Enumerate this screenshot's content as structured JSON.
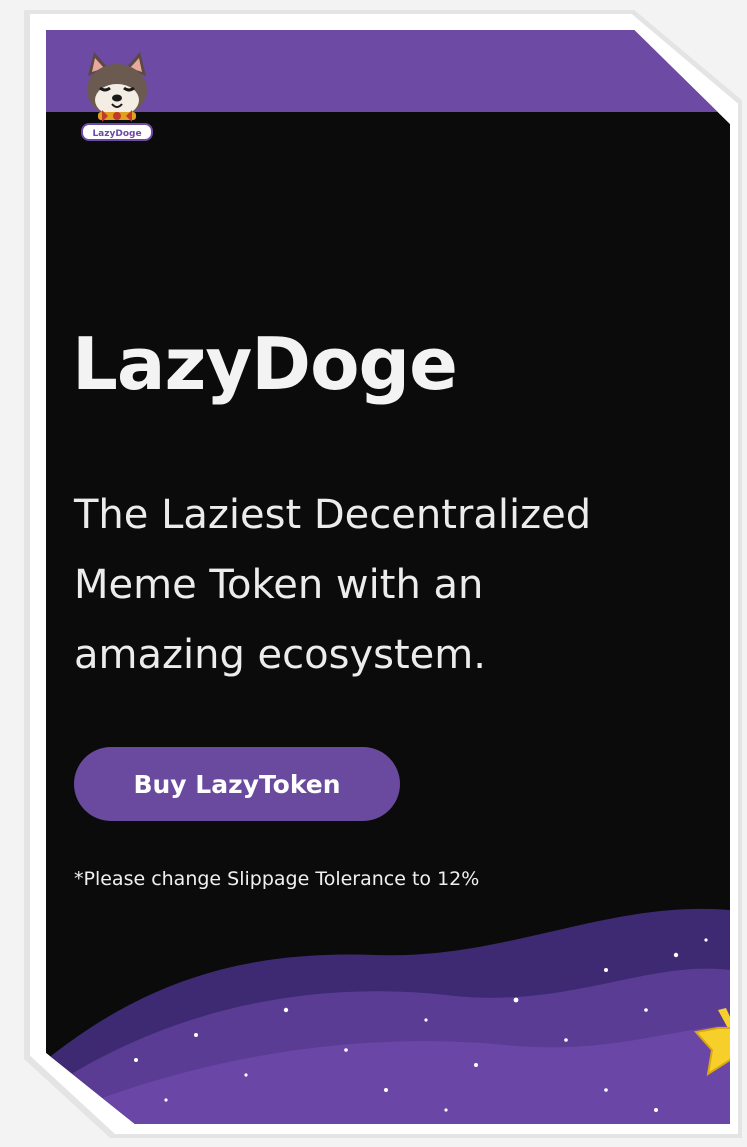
{
  "brand": {
    "logo_text": "LazyDoge",
    "headline": "LazyDoge"
  },
  "hero": {
    "tagline_lines": [
      "The Laziest Decentralized",
      "Meme Token with an",
      "amazing ecosystem."
    ]
  },
  "cta": {
    "buy_label": "Buy LazyToken"
  },
  "notice": {
    "text": "*Please change Slippage Tolerance to 12%"
  },
  "colors": {
    "brand_purple": "#6d4aa4",
    "button_purple": "#6a4a9e",
    "background": "#0b0b0b",
    "star_yellow": "#f6cf2a"
  },
  "icons": {
    "logo": "doge-mascot-icon",
    "star": "star-icon"
  }
}
